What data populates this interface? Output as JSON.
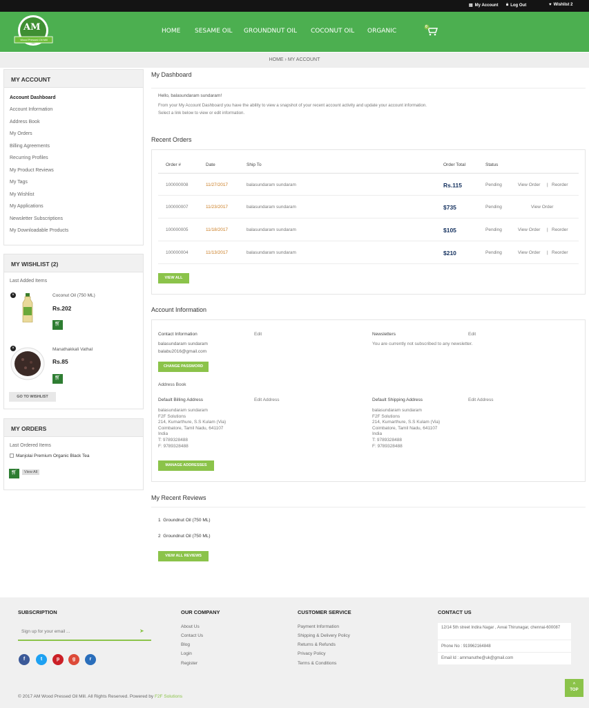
{
  "topbar": {
    "account": "My Account",
    "logout": "Log Out",
    "wishlist": "Wishlist 2"
  },
  "logo": {
    "initials": "AM",
    "ribbon": "Wood Pressed Oil Mill"
  },
  "nav": [
    "HOME",
    "SESAME OIL",
    "GROUNDNUT OIL",
    "COCONUT OIL",
    "ORGANIC"
  ],
  "cart": {
    "count": "0"
  },
  "breadcrumb": {
    "home": "HOME",
    "sep": "›",
    "current": "MY ACCOUNT"
  },
  "sidebar": {
    "title": "MY ACCOUNT",
    "items": [
      "Account Dashboard",
      "Account Information",
      "Address Book",
      "My Orders",
      "Billing Agreements",
      "Recurring Profiles",
      "My Product Reviews",
      "My Tags",
      "My Wishlist",
      "My Applications",
      "Newsletter Subscriptions",
      "My Downloadable Products"
    ]
  },
  "wishlist": {
    "title": "MY WISHLIST (2)",
    "subtitle": "Last Added Items",
    "items": [
      {
        "name": "Coconut Oil (750 ML)",
        "price": "Rs.202"
      },
      {
        "name": "Manathakkali Vathal",
        "price": "Rs.85"
      }
    ],
    "go_button": "GO TO WISHLIST"
  },
  "orders_box": {
    "title": "MY ORDERS",
    "subtitle": "Last Ordered Items",
    "item": "Manjolai Premium Organic Black Tea",
    "view_all": "View All"
  },
  "dashboard": {
    "title": "My Dashboard",
    "hello": "Hello, balasundaram sundaram!",
    "line1": "From your My Account Dashboard you have the ability to view a snapshot of your recent account activity and update your account information.",
    "line2": "Select a link below to view or edit information."
  },
  "recent_orders": {
    "title": "Recent Orders",
    "headers": {
      "order": "Order #",
      "date": "Date",
      "ship": "Ship To",
      "total": "Order Total",
      "status": "Status"
    },
    "rows": [
      {
        "order": "100000008",
        "date": "11/27/2017",
        "ship": "balasundaram sundaram",
        "total": "Rs.115",
        "status": "Pending",
        "view": "View Order",
        "reorder": "Reorder"
      },
      {
        "order": "100000007",
        "date": "11/23/2017",
        "ship": "balasundaram sundaram",
        "total": "$735",
        "status": "Pending",
        "view": "View Order",
        "reorder": ""
      },
      {
        "order": "100000005",
        "date": "11/18/2017",
        "ship": "balasundaram sundaram",
        "total": "$105",
        "status": "Pending",
        "view": "View Order",
        "reorder": "Reorder"
      },
      {
        "order": "100000004",
        "date": "11/13/2017",
        "ship": "balasundaram sundaram",
        "total": "$210",
        "status": "Pending",
        "view": "View Order",
        "reorder": "Reorder"
      }
    ],
    "sep": "|",
    "view_all": "VIEW ALL"
  },
  "account_info": {
    "title": "Account Information",
    "contact_label": "Contact Information",
    "edit": "Edit",
    "name": "balasundaram sundaram",
    "email": "balabu2016@gmail.com",
    "change_password": "CHANGE PASSWORD",
    "newsletters_label": "Newsletters",
    "newsletters_text": "You are currently not subscribed to any newsletter.",
    "address_book": "Address Book",
    "billing_label": "Default Billing Address",
    "shipping_label": "Default Shipping Address",
    "edit_address": "Edit Address",
    "address_lines": [
      "balasundaram sundaram",
      "F2F Solutions",
      "214, Kumarthure, S.S Kulam (Via)",
      "Coimbatore, Tamil Nadu, 641107",
      "India",
      "T: 9789328488",
      "F: 9789328488"
    ],
    "manage": "MANAGE ADDRESSES"
  },
  "reviews": {
    "title": "My Recent Reviews",
    "items": [
      {
        "num": "1",
        "name": "Groundnut Oil (750 ML)"
      },
      {
        "num": "2",
        "name": "Groundnut Oil (750 ML)"
      }
    ],
    "view_all": "VIEW ALL REVIEWS"
  },
  "footer": {
    "subscription": "SUBSCRIPTION",
    "placeholder": "Sign up for your email ...",
    "company_title": "OUR COMPANY",
    "company_links": [
      "About Us",
      "Contact Us",
      "Blog",
      "Login",
      "Register"
    ],
    "service_title": "CUSTOMER SERVICE",
    "service_links": [
      "Payment Information",
      "Shipping & Delivery Policy",
      "Returns & Refunds",
      "Privacy Policy",
      "Terms & Conditions"
    ],
    "contact_title": "CONTACT US",
    "address": "12/14 5th street Indira Nagar , Avvai Thirunagar, chennai-600087",
    "phone": "Phone No : 919962164848",
    "email": "Email Id : ammanuthe@uk@gmail.com",
    "copyright": "© 2017 AM Wood Pressed Oil Mill. All Rights Reserved. Powered by",
    "powered": "F2F Solutions",
    "top": "TOP"
  },
  "colors": {
    "green": "#4caf50",
    "light_green": "#8bc34a",
    "dark_green": "#2e7d32",
    "navy": "#14315f"
  }
}
